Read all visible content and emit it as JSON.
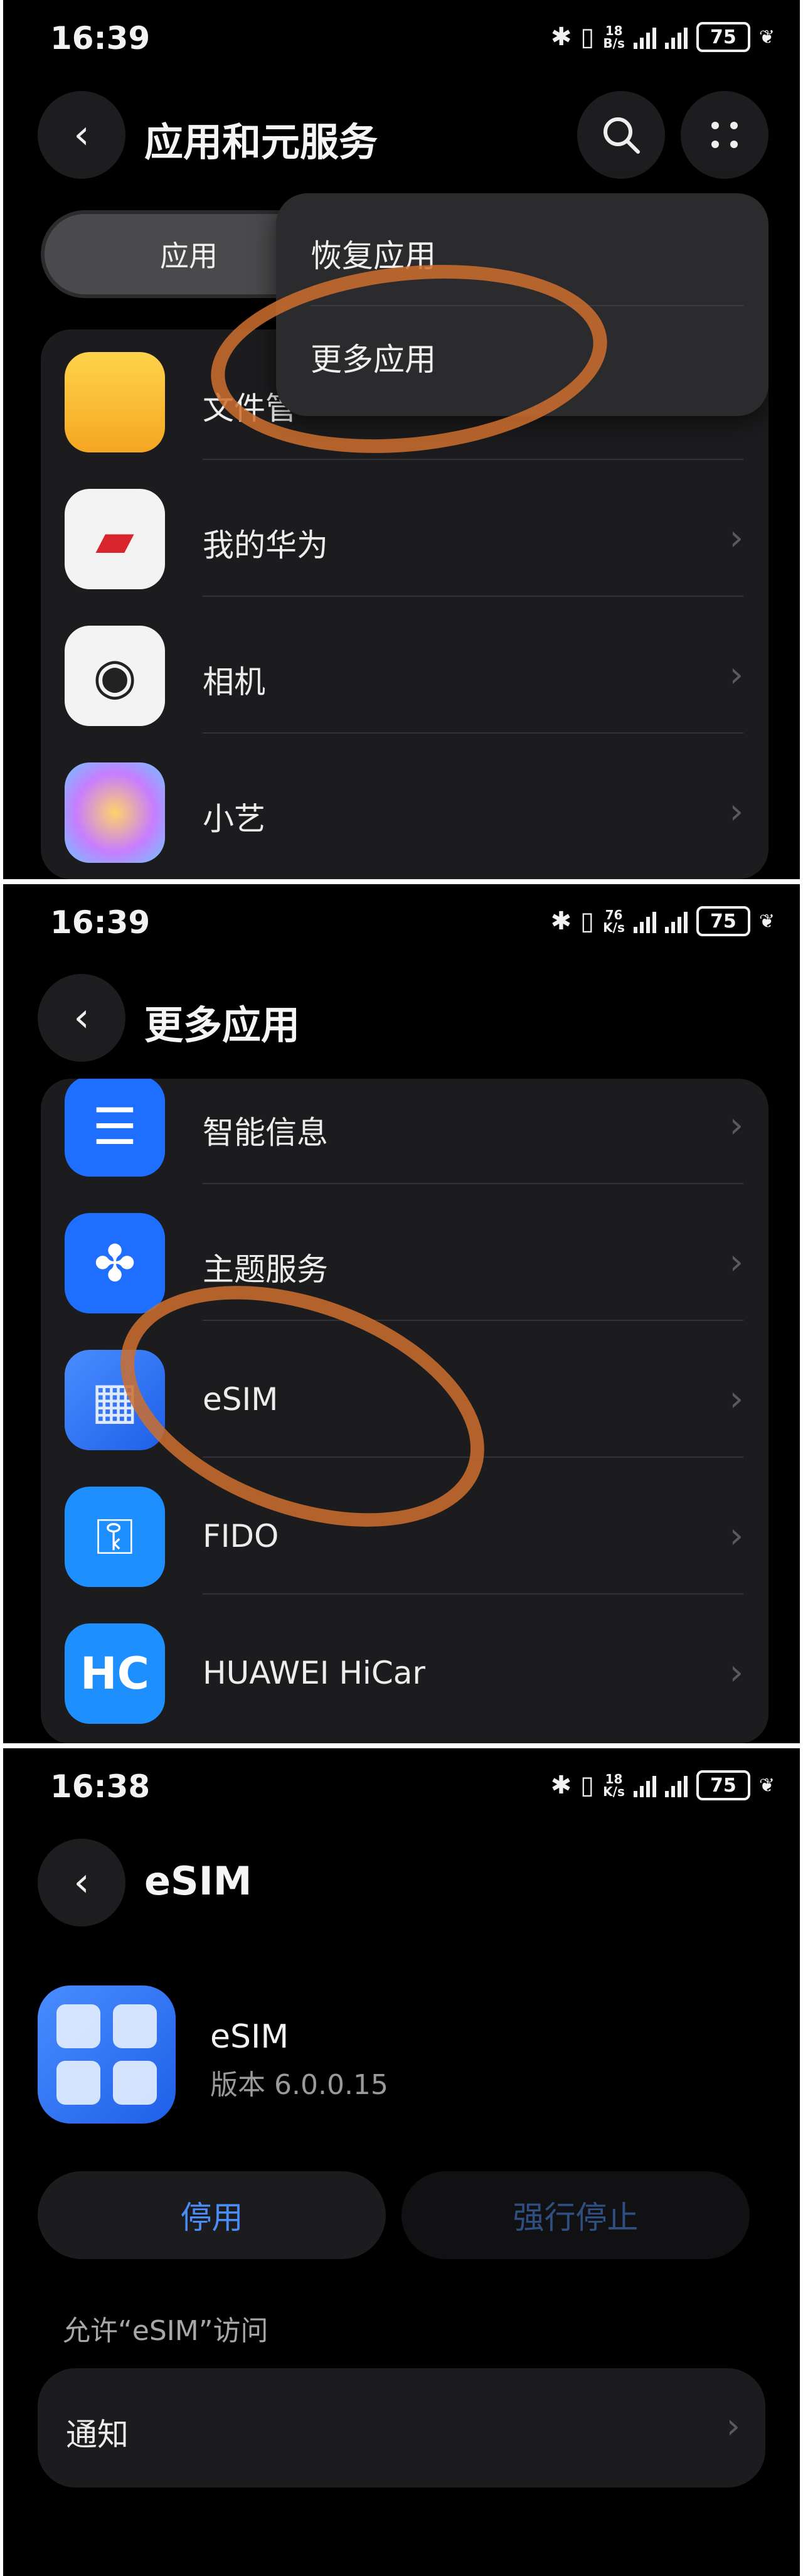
{
  "colors": {
    "accent": "#4a8df8",
    "disabled_text": "#2f4f82",
    "highlight": "#cd6e2d"
  },
  "screen1": {
    "time": "16:39",
    "speed_top": "18",
    "speed_bottom": "B/s",
    "battery": "75",
    "title": "应用和元服务",
    "tab_label": "应用",
    "menu": {
      "item1": "恢复应用",
      "item2": "更多应用"
    },
    "apps": [
      {
        "label": "文件管",
        "icon": "folder-icon"
      },
      {
        "label": "我的华为",
        "icon": "huawei-icon"
      },
      {
        "label": "相机",
        "icon": "camera-icon"
      },
      {
        "label": "小艺",
        "icon": "xiaoyi-icon"
      }
    ]
  },
  "screen2": {
    "time": "16:39",
    "speed_top": "76",
    "speed_bottom": "K/s",
    "battery": "75",
    "title": "更多应用",
    "apps": [
      {
        "label": "智能信息",
        "icon": "message-icon"
      },
      {
        "label": "主题服务",
        "icon": "theme-icon"
      },
      {
        "label": "eSIM",
        "icon": "esim-icon"
      },
      {
        "label": "FIDO",
        "icon": "key-icon"
      },
      {
        "label": "HUAWEI HiCar",
        "icon": "hicar-icon"
      }
    ]
  },
  "screen3": {
    "time": "16:38",
    "speed_top": "18",
    "speed_bottom": "K/s",
    "battery": "75",
    "title": "eSIM",
    "app_name": "eSIM",
    "version": "版本 6.0.0.15",
    "disable_label": "停用",
    "force_stop_label": "强行停止",
    "section_header": "允许“eSIM”访问",
    "notification_label": "通知"
  }
}
